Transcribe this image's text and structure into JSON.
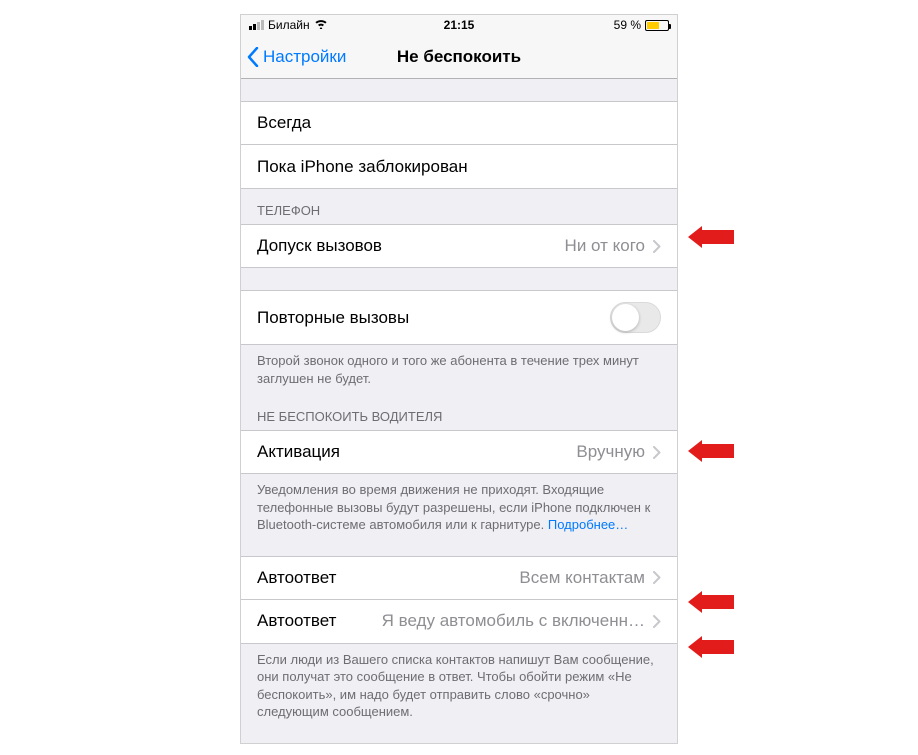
{
  "status": {
    "carrier": "Билайн",
    "time": "21:15",
    "battery_pct": "59 %",
    "battery_fill_pct": 59
  },
  "nav": {
    "back_label": "Настройки",
    "title": "Не беспокоить"
  },
  "silence_group": {
    "option_always": "Всегда",
    "option_locked": "Пока iPhone заблокирован"
  },
  "phone_section": {
    "header": "ТЕЛЕФОН",
    "allow_calls": {
      "label": "Допуск вызовов",
      "value": "Ни от кого"
    }
  },
  "repeated": {
    "label": "Повторные вызовы",
    "footer": "Второй звонок одного и того же абонента в течение трех минут заглушен не будет."
  },
  "driving": {
    "header": "НЕ БЕСПОКОИТЬ ВОДИТЕЛЯ",
    "activation": {
      "label": "Активация",
      "value": "Вручную"
    },
    "footer_text": "Уведомления во время движения не приходят. Входящие телефонные вызовы будут разрешены, если iPhone подключен к Bluetooth-системе автомобиля или к гарнитуре. ",
    "footer_link": "Подробнее…"
  },
  "autoreply": {
    "to": {
      "label": "Автоответ",
      "value": "Всем контактам"
    },
    "msg": {
      "label": "Автоответ",
      "value": "Я веду автомобиль с включенн…"
    },
    "footer": "Если люди из Вашего списка контактов напишут Вам сообщение, они получат это сообщение в ответ. Чтобы обойти режим «Не беспокоить», им надо будет отправить слово «срочно» следующим сообщением."
  }
}
